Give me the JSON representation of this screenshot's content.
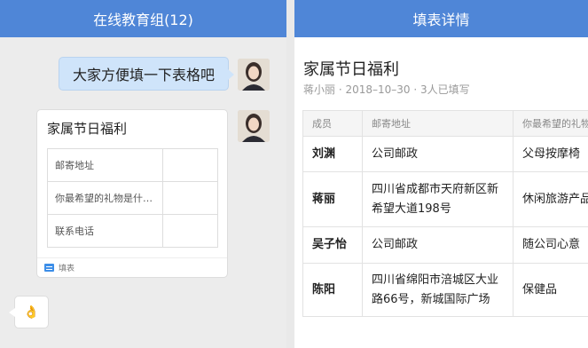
{
  "chat": {
    "title": "在线教育组(12)",
    "message": "大家方便填一下表格吧",
    "card": {
      "title": "家属节日福利",
      "fields": [
        "邮寄地址",
        "你最希望的礼物是什…",
        "联系电话"
      ],
      "footer_label": "填表"
    },
    "reply_emoji": "👌"
  },
  "detail": {
    "title": "填表详情",
    "form_title": "家属节日福利",
    "meta": "蒋小丽 · 2018–10–30 · 3人已填写",
    "columns": [
      "成员",
      "邮寄地址",
      "你最希望的礼物"
    ],
    "rows": [
      {
        "name": "刘渊",
        "address": "公司邮政",
        "gift": "父母按摩椅"
      },
      {
        "name": "蒋丽",
        "address": "四川省成都市天府新区新希望大道198号",
        "gift": "休闲旅游产品"
      },
      {
        "name": "吴子怡",
        "address": "公司邮政",
        "gift": "随公司心意"
      },
      {
        "name": "陈阳",
        "address": "四川省绵阳市涪城区大业路66号，新城国际广场",
        "gift": "保健品"
      }
    ]
  }
}
